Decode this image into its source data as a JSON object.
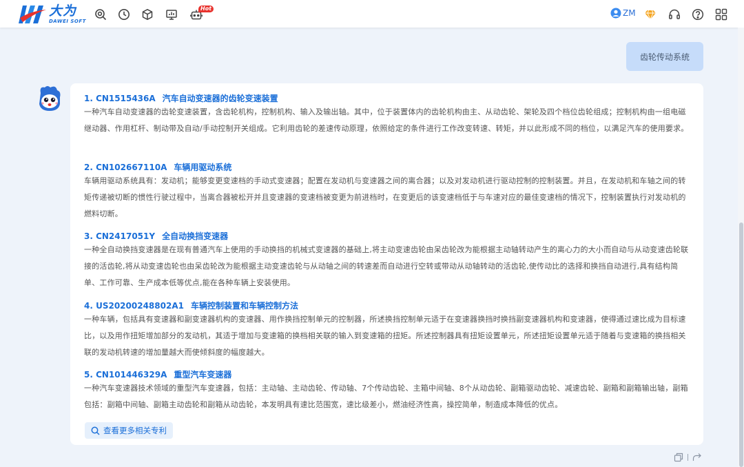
{
  "app": {
    "logo_cn": "大为",
    "logo_en": "DAWEI SOFT",
    "hot_label": "Hot",
    "user_name": "ZM"
  },
  "conversation": {
    "user_query": "齿轮传动系统",
    "results": [
      {
        "number": "1. CN1515436A",
        "title": "汽车自动变速器的齿轮变速装置",
        "description": "一种汽车自动变速器的齿轮变速装置，含齿轮机构，控制机构、输入及输出轴。其中，位于装置体内的齿轮机构由主、从动齿轮、架轮及四个档位齿轮组成；控制机构由一组电磁继动器、作用杠杆、制动带及自动/手动控制开关组成。它利用齿轮的差速传动原理，依照给定的条件进行工作改变转速、转矩，并以此形成不同的档位，以满足汽车的使用要求。"
      },
      {
        "number": "2. CN102667110A",
        "title": "车辆用驱动系统",
        "description": "车辆用驱动系统具有：发动机；能够变更变速档的手动式变速器；配置在发动机与变速器之间的离合器；以及对发动机进行驱动控制的控制装置。并且，在发动机和车轴之间的转矩传递被切断的惯性行驶过程中，当离合器被松开并且变速器的变速档被变更为前进档时，在变更后的该变速档低于与车速对应的最佳变速档的情况下，控制装置执行对发动机的燃料切断。"
      },
      {
        "number": "3. CN2417051Y",
        "title": "全自动换挡变速器",
        "description": "一种全自动换挡变速器是在现有普通汽车上使用的手动换挡的机械式变速器的基础上,将主动变速齿轮由呆齿轮改为能根据主动轴转动产生的离心力的大小而自动与从动变速齿轮联接的活齿轮,将从动变速齿轮也由呆齿轮改为能根据主动变速齿轮与从动轴之间的转速差而自动进行空转或带动从动轴转动的活齿轮,使传动比的选择和换挡自动进行,具有结构简单、工作可靠、生产成本低等优点,能在各种车辆上安装使用。"
      },
      {
        "number": "4. US20200248802A1",
        "title": "车辆控制装置和车辆控制方法",
        "description": "一种车辆，包括具有变速器和副变速器机构的变速器、用作换挡控制单元的控制器，所述换挡控制单元适于在变速器换挡时换挡副变速器机构和变速器，使得通过速比成为目标速比，以及用作扭矩增加部分的发动机，其适于增加与变速箱的换档相关联的输入到变速箱的扭矩。所述控制器具有扭矩设置单元，所述扭矩设置单元适于随着与变速箱的换挡相关联的发动机转速的增加量越大而使倾斜度的幅度越大。"
      },
      {
        "number": "5. CN101446329A",
        "title": "重型汽车变速器",
        "description": "一种汽车变速器技术领域的重型汽车变速器，包括：主动轴、主动齿轮、传动轴、7个传动齿轮、主箱中间轴、8个从动齿轮、副箱驱动齿轮、减速齿轮、副箱和副箱输出轴，副箱包括：副箱中间轴、副箱主动齿轮和副箱从动齿轮，本发明具有速比范围宽，速比级差小，燃油经济性高，操控简单，制造成本降低的优点。"
      }
    ],
    "more_button": "查看更多相关专利"
  },
  "icons": {
    "toolbar": [
      "search-analysis-icon",
      "history-clock-icon",
      "cube-icon",
      "monitor-chart-icon",
      "robot-icon"
    ],
    "right": [
      "user-avatar-icon",
      "diamond-icon",
      "headset-icon",
      "help-icon",
      "grid-apps-icon"
    ],
    "footer": [
      "copy-icon",
      "share-icon"
    ]
  },
  "colors": {
    "accent": "#1b6fd8",
    "user_bubble": "#c6dcfa",
    "background": "#eef3fa",
    "hot_badge": "#e8322d",
    "diamond": "#f5a623"
  }
}
